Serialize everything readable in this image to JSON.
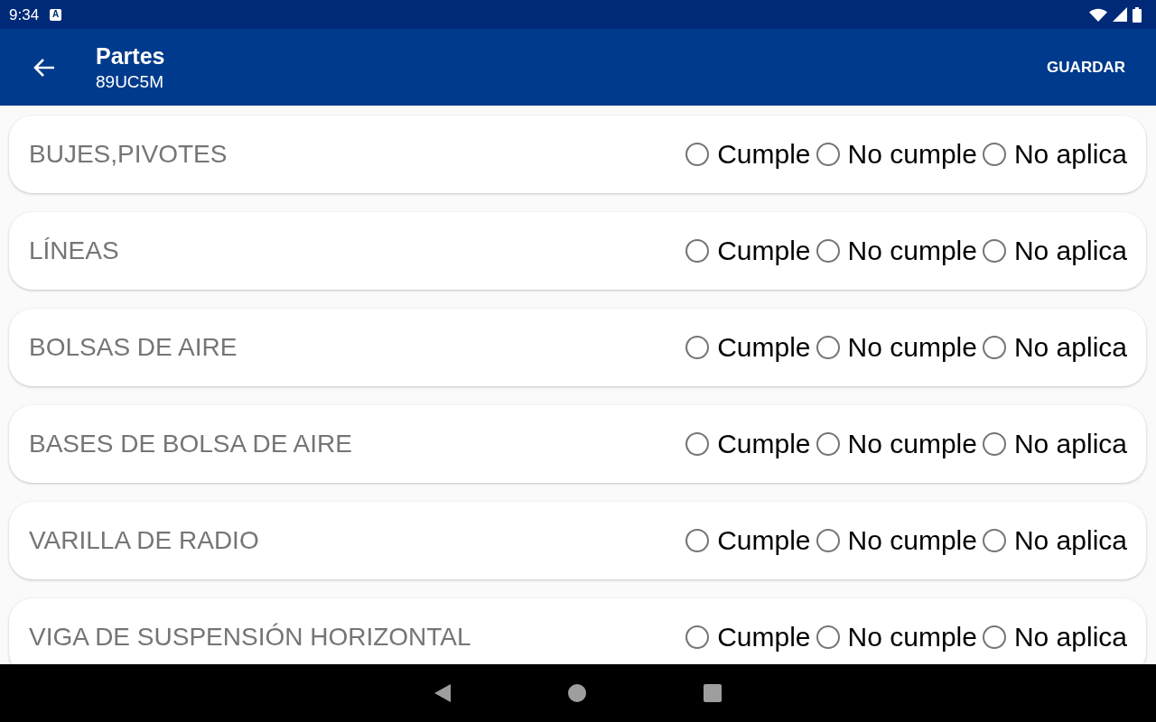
{
  "status_bar": {
    "time": "9:34",
    "notification_icon": "A"
  },
  "app_bar": {
    "title": "Partes",
    "subtitle": "89UC5M",
    "action": "GUARDAR"
  },
  "items": [
    {
      "label": "BUJES,PIVOTES",
      "options": [
        {
          "label": "Cumple",
          "selected": false
        },
        {
          "label": "No cumple",
          "selected": false
        },
        {
          "label": "No aplica",
          "selected": false
        }
      ]
    },
    {
      "label": "LÍNEAS",
      "options": [
        {
          "label": "Cumple",
          "selected": false
        },
        {
          "label": "No cumple",
          "selected": false
        },
        {
          "label": "No aplica",
          "selected": false
        }
      ]
    },
    {
      "label": "BOLSAS DE AIRE",
      "options": [
        {
          "label": "Cumple",
          "selected": false
        },
        {
          "label": "No cumple",
          "selected": false
        },
        {
          "label": "No aplica",
          "selected": false
        }
      ]
    },
    {
      "label": "BASES DE BOLSA DE AIRE",
      "options": [
        {
          "label": "Cumple",
          "selected": false
        },
        {
          "label": "No cumple",
          "selected": false
        },
        {
          "label": "No aplica",
          "selected": false
        }
      ]
    },
    {
      "label": "VARILLA DE RADIO",
      "options": [
        {
          "label": "Cumple",
          "selected": false
        },
        {
          "label": "No cumple",
          "selected": false
        },
        {
          "label": "No aplica",
          "selected": false
        }
      ]
    },
    {
      "label": "VIGA DE SUSPENSIÓN HORIZONTAL",
      "options": [
        {
          "label": "Cumple",
          "selected": false
        },
        {
          "label": "No cumple",
          "selected": false
        },
        {
          "label": "No aplica",
          "selected": false
        }
      ]
    }
  ]
}
